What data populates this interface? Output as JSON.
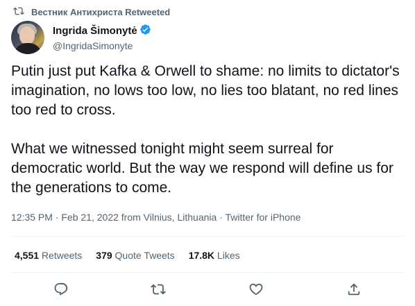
{
  "retweet_context": {
    "label": "Вестник Антихриста Retweeted"
  },
  "author": {
    "display_name": "Ingrida Šimonytė",
    "handle": "@IngridaSimonyte"
  },
  "tweet": {
    "text": "Putin just put Kafka & Orwell to shame: no limits to dictator's imagination, no lows too low, no lies too blatant, no red lines too red to cross.\n\nWhat we witnessed tonight might seem surreal for democratic world. But the way we respond will define us for the generations to come."
  },
  "meta": {
    "time": "12:35 PM",
    "date": "Feb 21, 2022",
    "location": "from Vilnius, Lithuania",
    "source": "Twitter for iPhone"
  },
  "stats": {
    "retweets_count": "4,551",
    "retweets_label": "Retweets",
    "quotes_count": "379",
    "quotes_label": "Quote Tweets",
    "likes_count": "17.8K",
    "likes_label": "Likes"
  },
  "icons": {
    "retweet": "retweet-icon",
    "verified": "verified-badge-icon",
    "reply": "reply-icon",
    "like": "like-icon",
    "share": "share-icon"
  },
  "colors": {
    "secondary_text": "#536471",
    "verified_blue": "#1d9bf0",
    "divider": "#eff3f4"
  }
}
